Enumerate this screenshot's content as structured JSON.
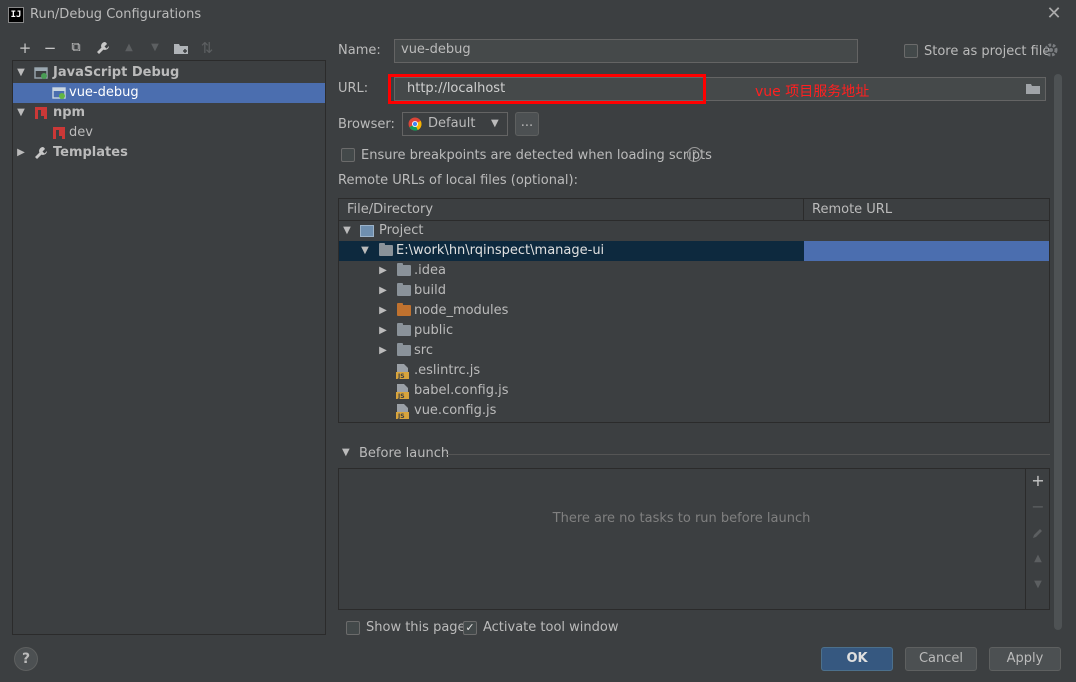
{
  "window": {
    "title": "Run/Debug Configurations",
    "app_icon": "IJ"
  },
  "toolbar": {
    "add": "+",
    "remove": "−",
    "copy": "⧉",
    "edit": "🔧",
    "up": "▲",
    "down": "▼",
    "folder": "📁",
    "sort": "⇅"
  },
  "tree": {
    "js_debug": "JavaScript Debug",
    "vue_debug": "vue-debug",
    "npm": "npm",
    "dev": "dev",
    "templates": "Templates"
  },
  "form": {
    "name_label": "Name:",
    "name_value": "vue-debug",
    "store_label": "Store as project file",
    "url_label": "URL:",
    "url_value": "http://localhost",
    "annotation": "vue 项目服务地址",
    "browser_label": "Browser:",
    "browser_value": "Default",
    "more_button": "...",
    "ensure_label": "Ensure breakpoints are detected when loading scripts",
    "remote_urls_label": "Remote URLs of local files (optional):"
  },
  "table": {
    "headers": [
      "File/Directory",
      "Remote URL"
    ],
    "rows": [
      "Project",
      "E:\\work\\hn\\rqinspect\\manage-ui",
      ".idea",
      "build",
      "node_modules",
      "public",
      "src",
      ".eslintrc.js",
      "babel.config.js",
      "vue.config.js"
    ]
  },
  "before_launch": {
    "title": "Before launch",
    "empty": "There are no tasks to run before launch"
  },
  "footer": {
    "show_page": "Show this page",
    "activate": "Activate tool window",
    "ok": "OK",
    "cancel": "Cancel",
    "apply": "Apply",
    "help": "?"
  },
  "colors": {
    "selection": "#4b6eaf",
    "annotation": "#ff0000",
    "primary_button": "#365880"
  }
}
